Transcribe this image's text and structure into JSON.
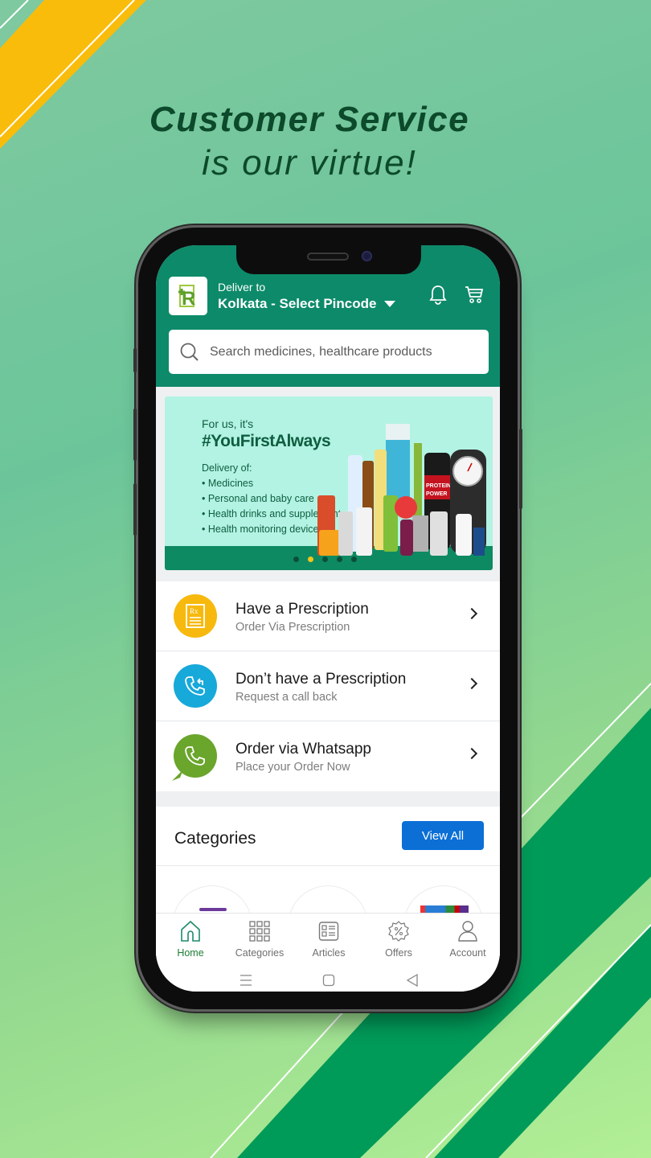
{
  "promo": {
    "headline_line1": "Customer Service",
    "headline_line2": "is our virtue!"
  },
  "colors": {
    "brand_green": "#0d8a6a",
    "accent_yellow": "#f9bc0b",
    "primary_blue": "#0b6fd6",
    "prescription_icon_bg": "#f7b90e",
    "callback_icon_bg": "#17a9d9",
    "whatsapp_icon_bg": "#6aa52c",
    "active_tab": "#1d7d35"
  },
  "header": {
    "logo_icon": "rx-plus-logo",
    "deliver_label": "Deliver to",
    "location": "Kolkata - Select Pincode",
    "notification_icon": "bell-icon",
    "cart_icon": "cart-icon"
  },
  "search": {
    "placeholder": "Search medicines, healthcare products",
    "value": ""
  },
  "banner": {
    "intro": "For us, it's",
    "hashtag": "#YouFirstAlways",
    "delivery_heading": "Delivery of:",
    "delivery_items": [
      "• Medicines",
      "• Personal and baby care",
      "• Health drinks and supplements",
      "• Health monitoring devices"
    ],
    "slides_total": 5,
    "active_slide": 2
  },
  "order_options": [
    {
      "title": "Have a Prescription",
      "subtitle": "Order Via Prescription",
      "icon": "prescription-icon"
    },
    {
      "title": "Don’t have a Prescription",
      "subtitle": "Request a call back",
      "icon": "callback-phone-icon"
    },
    {
      "title": "Order via Whatsapp",
      "subtitle": "Place your Order Now",
      "icon": "whatsapp-icon"
    }
  ],
  "categories": {
    "title": "Categories",
    "view_all_label": "View All"
  },
  "tabs": [
    {
      "label": "Home",
      "icon": "home-icon",
      "active": true
    },
    {
      "label": "Categories",
      "icon": "grid-icon",
      "active": false
    },
    {
      "label": "Articles",
      "icon": "articles-icon",
      "active": false
    },
    {
      "label": "Offers",
      "icon": "offer-badge-icon",
      "active": false
    },
    {
      "label": "Account",
      "icon": "user-icon",
      "active": false
    }
  ],
  "system_nav": [
    "menu",
    "home",
    "back"
  ]
}
